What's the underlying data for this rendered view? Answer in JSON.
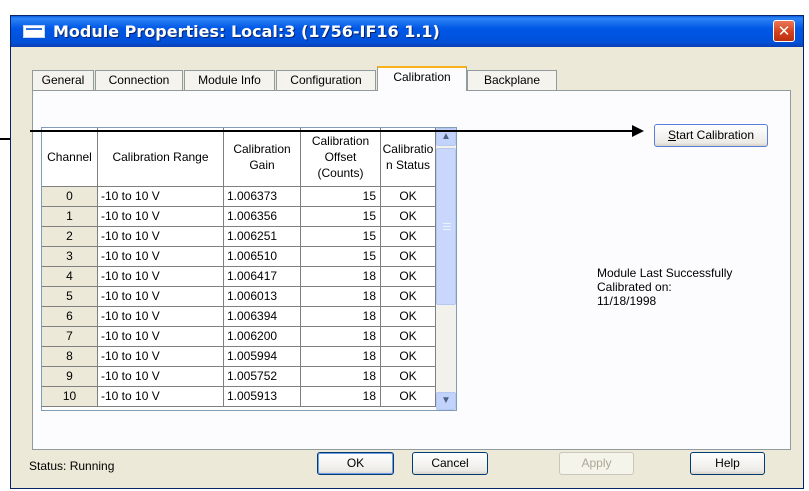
{
  "window": {
    "title": "Module Properties: Local:3 (1756-IF16 1.1)",
    "close_glyph": "✕"
  },
  "tabs": [
    {
      "label": "General",
      "active": false
    },
    {
      "label": "Connection",
      "active": false
    },
    {
      "label": "Module Info",
      "active": false
    },
    {
      "label": "Configuration",
      "active": false
    },
    {
      "label": "Calibration",
      "active": true
    },
    {
      "label": "Backplane",
      "active": false
    }
  ],
  "calibration_table": {
    "columns": [
      "Channel",
      "Calibration Range",
      "Calibration Gain",
      "Calibration Offset (Counts)",
      "Calibration Status"
    ],
    "rows": [
      {
        "channel": "0",
        "range": "-10 to 10 V",
        "gain": "1.006373",
        "offset": "15",
        "status": "OK"
      },
      {
        "channel": "1",
        "range": "-10 to 10 V",
        "gain": "1.006356",
        "offset": "15",
        "status": "OK"
      },
      {
        "channel": "2",
        "range": "-10 to 10 V",
        "gain": "1.006251",
        "offset": "15",
        "status": "OK"
      },
      {
        "channel": "3",
        "range": "-10 to 10 V",
        "gain": "1.006510",
        "offset": "15",
        "status": "OK"
      },
      {
        "channel": "4",
        "range": "-10 to 10 V",
        "gain": "1.006417",
        "offset": "18",
        "status": "OK"
      },
      {
        "channel": "5",
        "range": "-10 to 10 V",
        "gain": "1.006013",
        "offset": "18",
        "status": "OK"
      },
      {
        "channel": "6",
        "range": "-10 to 10 V",
        "gain": "1.006394",
        "offset": "18",
        "status": "OK"
      },
      {
        "channel": "7",
        "range": "-10 to 10 V",
        "gain": "1.006200",
        "offset": "18",
        "status": "OK"
      },
      {
        "channel": "8",
        "range": "-10 to 10 V",
        "gain": "1.005994",
        "offset": "18",
        "status": "OK"
      },
      {
        "channel": "9",
        "range": "-10 to 10 V",
        "gain": "1.005752",
        "offset": "18",
        "status": "OK"
      },
      {
        "channel": "10",
        "range": "-10 to 10 V",
        "gain": "1.005913",
        "offset": "18",
        "status": "OK"
      }
    ]
  },
  "start_calibration_button": {
    "label_first": "S",
    "label_rest": "tart Calibration"
  },
  "last_calibrated": {
    "line1": "Module Last Successfully",
    "line2": "Calibrated on:",
    "date": "11/18/1998"
  },
  "status": {
    "text": "Status:  Running"
  },
  "buttons": {
    "ok": "OK",
    "cancel": "Cancel",
    "apply": "Apply",
    "help": "Help"
  },
  "colors": {
    "title_bar": "#0058E6",
    "dialog_face": "#ECE9D8",
    "active_tab_accent": "#F9B119"
  },
  "icons": {
    "scroll_up": "scroll-up-arrow-icon",
    "scroll_down": "scroll-down-arrow-icon",
    "window": "window-icon",
    "close": "close-icon"
  }
}
